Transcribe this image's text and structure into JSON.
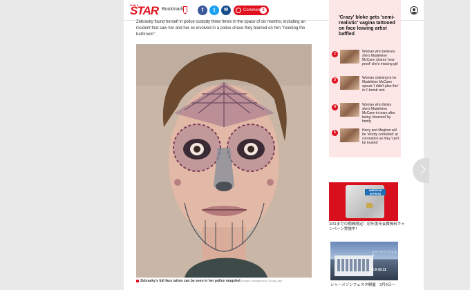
{
  "header": {
    "logo_small": "DAILY",
    "logo": "STAR",
    "bookmark_label": "Bookmark",
    "comments_label": "Comments",
    "comments_count": "2"
  },
  "article": {
    "body_text": "Zebrasky found herself in police custody three times in the space of six months, including an incident that saw her and her ex involved in a police chase they blamed on him \"needing the bathroom\".",
    "caption": "Zebrasky's full face tattoo can be seen in her police mugshot",
    "caption_credit": "(Image: Montgomery County Jail)"
  },
  "sidebar": {
    "lead": "'Crazy' bloke gets 'semi-realistic' vagina tattooed on face leaving artist baffled",
    "items": [
      {
        "num": "2",
        "title": "Woman who believes she's Madeleine McCann shares 'new proof' she's missing girl"
      },
      {
        "num": "3",
        "title": "Woman claiming to be Madeleine McCann spouts 'I didn't plan this' in F-bomb rant"
      },
      {
        "num": "4",
        "title": "Woman who thinks she's Madeleine McCann in tears after being 'shunned' by family"
      },
      {
        "num": "5",
        "title": "Harry and Meghan will be 'strictly controlled' at coronation as they 'can't be trusted'"
      }
    ]
  },
  "ads": {
    "amex_logo": "AMERICAN EXPRESS",
    "ad1_text": "3/31までの期間限定！初年度年会費無料キャンペーン実施中！",
    "ad2_text1": "シャーメゾンフェスタ",
    "ad2_date": "3.9-10.11",
    "ad2_text2": "シャーメゾンフェスタ開催　3月9日〜"
  },
  "colors": {
    "brand_red": "#e0101e",
    "sidebar_bg": "#fde6e6"
  }
}
